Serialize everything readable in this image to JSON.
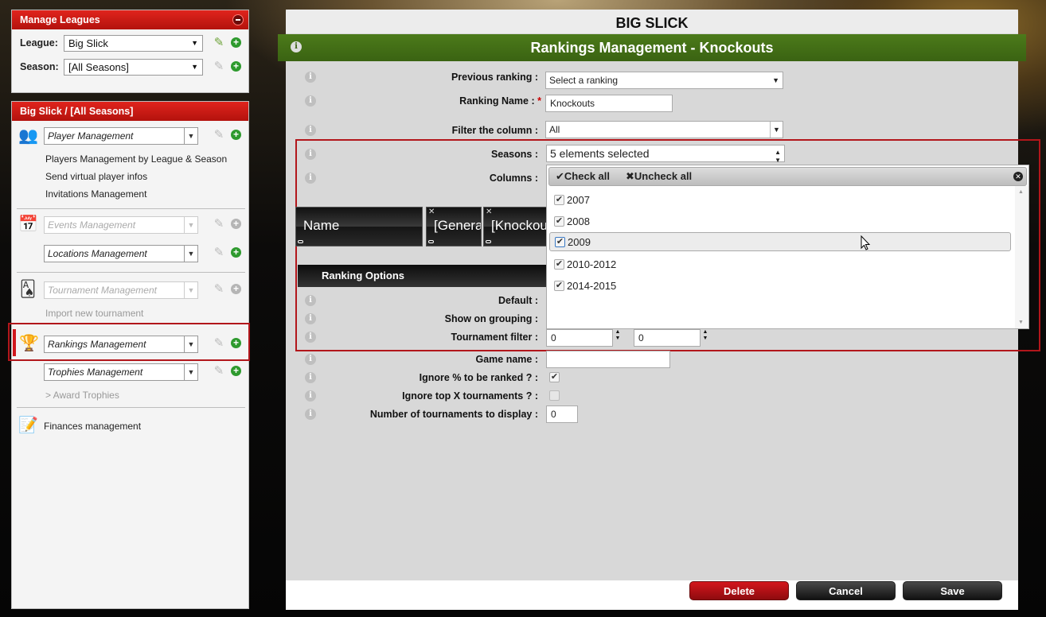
{
  "manage_leagues": {
    "title": "Manage Leagues",
    "league_label": "League:",
    "league_value": "Big Slick",
    "season_label": "Season:",
    "season_value": "[All Seasons]"
  },
  "nav": {
    "title": "Big Slick / [All Seasons]",
    "player_management": "Player Management",
    "players_by_league": "Players Management by League & Season",
    "send_virtual": "Send virtual player infos",
    "invitations": "Invitations Management",
    "events_management": "Events Management",
    "locations_management": "Locations Management",
    "tournament_management": "Tournament Management",
    "import_tournament": "Import new tournament",
    "rankings_management": "Rankings Management",
    "trophies_management": "Trophies Management",
    "award_trophies": "> Award Trophies",
    "finances_management": "Finances management"
  },
  "main": {
    "league_title": "BIG SLICK",
    "section_title": "Rankings Management - Knockouts",
    "previous_ranking_label": "Previous ranking :",
    "previous_ranking_value": "Select a ranking",
    "ranking_name_label": "Ranking Name :",
    "required_mark": "*",
    "ranking_name_value": "Knockouts",
    "filter_label": "Filter the column :",
    "filter_value": "All",
    "seasons_label": "Seasons :",
    "seasons_value": "5 elements selected",
    "columns_label": "Columns :",
    "columns": [
      "Name",
      "[Genera",
      "[Knockou"
    ],
    "ranking_options": "Ranking Options",
    "default_label": "Default :",
    "grouping_label": "Show on grouping :",
    "tournament_filter_label": "Tournament filter :",
    "tournament_filter_a": "0",
    "tournament_filter_b": "0",
    "game_name_label": "Game name :",
    "ignore_pct_label": "Ignore % to be ranked ? :",
    "ignore_top_label": "Ignore top X tournaments ? :",
    "num_tournaments_label": "Number of tournaments to display :",
    "num_tournaments_value": "0"
  },
  "seasons_dropdown": {
    "check_all": "Check all",
    "uncheck_all": "Uncheck all",
    "items": [
      "2007",
      "2008",
      "2009",
      "2010-2012",
      "2014-2015"
    ]
  },
  "buttons": {
    "delete": "Delete",
    "cancel": "Cancel",
    "save": "Save"
  }
}
